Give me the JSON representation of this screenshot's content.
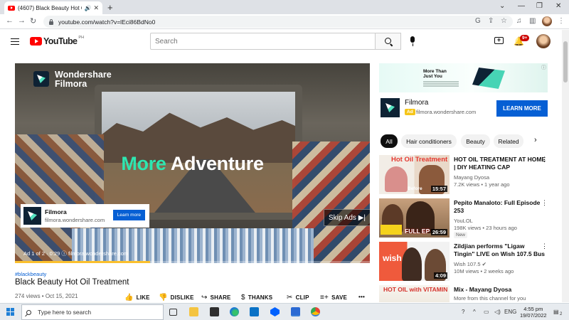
{
  "browser": {
    "tab_title": "(4607) Black Beauty Hot Oil T",
    "tab_mute_icon": "speaker-icon",
    "url": "youtube.com/watch?v=lEci86BdNo0"
  },
  "youtube": {
    "logo_text": "YouTube",
    "region": "PH",
    "search_placeholder": "Search",
    "notifications_count": "9+"
  },
  "player": {
    "brand_line1": "Wondershare",
    "brand_line2": "Filmora",
    "headline_accent": "More",
    "headline_rest": " Adventure",
    "ad_card_title": "Filmora",
    "ad_card_domain": "filmora.wondershare.com",
    "ad_card_button": "Learn more",
    "skip_label": "Skip Ads ▶|",
    "ad_info": "Ad 1 of 2 · 0:29 ⓘ filmora.wondershare.com",
    "progress": 0.38
  },
  "video": {
    "hashtag": "#blackbeauty",
    "title": "Black Beauty Hot Oil Treatment",
    "meta": "274 views • Oct 15, 2021",
    "actions": [
      {
        "glyph": "👍",
        "label": "LIKE"
      },
      {
        "glyph": "👎",
        "label": "DISLIKE"
      },
      {
        "glyph": "↪",
        "label": "SHARE"
      },
      {
        "glyph": "$",
        "label": "THANKS"
      },
      {
        "glyph": "✂",
        "label": "CLIP"
      },
      {
        "glyph": "≡+",
        "label": "SAVE"
      },
      {
        "glyph": "",
        "label": "•••"
      }
    ]
  },
  "sidebar_ad": {
    "banner_heading_1": "More Than",
    "banner_heading_2": "Just You",
    "brand": "Filmora",
    "badge": "Ad",
    "domain": "filmora.wondershare.com",
    "cta": "LEARN MORE"
  },
  "chips": [
    "All",
    "Hair conditioners",
    "Beauty",
    "Related"
  ],
  "recommendations": [
    {
      "title": "HOT OIL TREATMENT AT HOME | DIY HEATING CAP",
      "channel": "Mayang Dyosa",
      "stats": "7.2K views • 1 year ago",
      "duration": "15:57",
      "overlay_top": "Hot Oil Treatment",
      "overlay_bottom": "Before",
      "new": ""
    },
    {
      "title": "Pepito Manaloto: Full Episode 253",
      "channel": "YouLOL",
      "stats": "198K views • 23 hours ago",
      "duration": "26:59",
      "overlay_top": "",
      "overlay_bottom": "FULL EP",
      "new": "New"
    },
    {
      "title": "Zildjian performs \"Ligaw Tingin\" LIVE on Wish 107.5 Bus",
      "channel": "Wish 107.5 ✔",
      "stats": "10M views • 2 weeks ago",
      "duration": "4:09",
      "overlay_top": "wish",
      "overlay_bottom": "",
      "new": ""
    },
    {
      "title": "Mix - Mayang Dyosa",
      "channel": "More from this channel for you",
      "stats": "",
      "duration": "",
      "overlay_top": "HOT OIL with VITAMIN E",
      "overlay_bottom": "",
      "new": ""
    }
  ],
  "taskbar": {
    "search_placeholder": "Type here to search",
    "lang": "ENG",
    "time": "4:55 pm",
    "date": "19/07/2022",
    "notification_count": "2"
  }
}
